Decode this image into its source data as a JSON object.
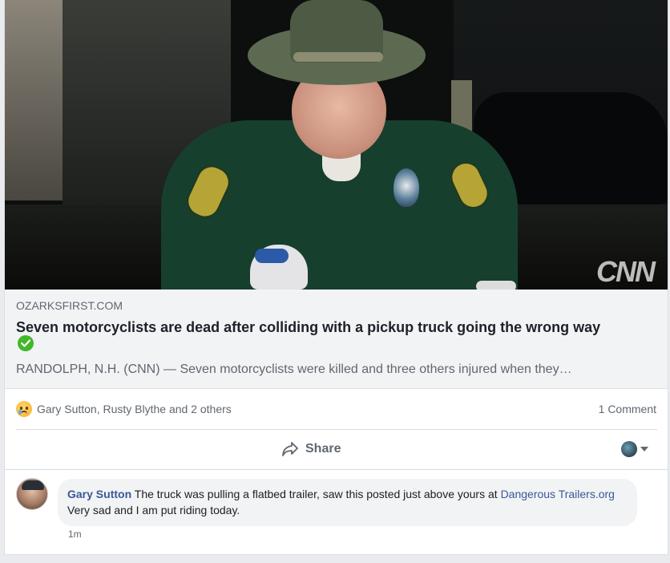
{
  "media": {
    "watermark": "CNN"
  },
  "link_preview": {
    "domain": "OZARKSFIRST.COM",
    "headline": "Seven motorcyclists are dead after colliding with a pickup truck going the wrong way",
    "description": "RANDOLPH, N.H. (CNN) — Seven motorcyclists were killed and three others injured when they…",
    "verified_icon": "check-circle-icon"
  },
  "reactions": {
    "icon": "sad-reaction-icon",
    "names": "Gary Sutton, Rusty Blythe and 2 others",
    "comment_count": "1 Comment"
  },
  "actions": {
    "share_label": "Share",
    "share_icon": "share-arrow-icon",
    "audience_icon": "profile-selector-icon"
  },
  "comment": {
    "author": "Gary Sutton",
    "text_before": " The truck was pulling a flatbed trailer, saw this posted just above yours at ",
    "link_text": "Dangerous Trailers.org",
    "text_after": " Very sad and I am put riding today.",
    "timestamp": "1m"
  },
  "colors": {
    "link": "#385898",
    "secondary_text": "#606770",
    "verified": "#42b72a"
  }
}
